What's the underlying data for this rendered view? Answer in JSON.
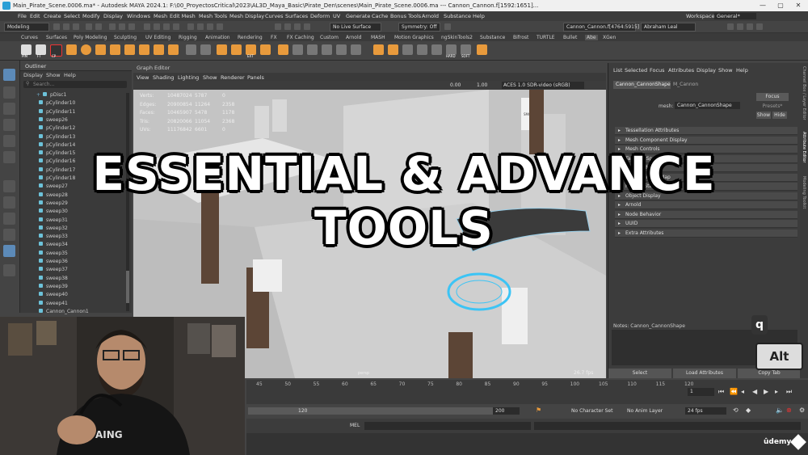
{
  "window": {
    "title": "Main_Pirate_Scene.0006.ma* - Autodesk MAYA 2024.1: F:\\00_ProyectosCritical\\2023\\AL3D_Maya_Basic\\Pirate_Den\\scenes\\Main_Pirate_Scene.0006.ma   ---   Cannon_Cannon.f[1592:1651]...",
    "minimize": "—",
    "maximize": "▢",
    "close": "✕"
  },
  "menubar": [
    "File",
    "Edit",
    "Create",
    "Select",
    "Modify",
    "Display",
    "Windows",
    "Mesh",
    "Edit Mesh",
    "Mesh Tools",
    "Mesh Display",
    "Curves",
    "Surfaces",
    "Deform",
    "UV",
    "Generate",
    "Cache",
    "Bonus Tools",
    "Arnold",
    "Substance",
    "Help"
  ],
  "workspace": {
    "label": "Workspace:",
    "value": "General*"
  },
  "statusline": {
    "mode": "Modeling",
    "live_surface": "No Live Surface",
    "symmetry": "Symmetry: Off",
    "selection_field": "Cannon_Cannon.f[4764:5915]",
    "user": "Abraham Leal"
  },
  "shelf_tabs": [
    "Curves",
    "Surfaces",
    "Poly Modeling",
    "Sculpting",
    "UV Editing",
    "Rigging",
    "Animation",
    "Rendering",
    "FX",
    "FX Caching",
    "Custom",
    "Arnold",
    "MASH",
    "Motion Graphics",
    "ngSkinTools2",
    "Substance",
    "Bifrost",
    "TURTLE",
    "Bullet",
    "Abe",
    "XGen"
  ],
  "shelf_labels": [
    "PIM",
    "FT",
    "CP",
    "EXT",
    "HARD",
    "SOFT"
  ],
  "outliner": {
    "title": "Outliner",
    "menu": [
      "Display",
      "Show",
      "Help"
    ],
    "search_placeholder": "Search...",
    "items": [
      {
        "label": "pDisc1",
        "expand": "+"
      },
      {
        "label": "pCylinder10",
        "expand": ""
      },
      {
        "label": "pCylinder11",
        "expand": ""
      },
      {
        "label": "sweep26",
        "expand": ""
      },
      {
        "label": "pCylinder12",
        "expand": ""
      },
      {
        "label": "pCylinder13",
        "expand": ""
      },
      {
        "label": "pCylinder14",
        "expand": ""
      },
      {
        "label": "pCylinder15",
        "expand": ""
      },
      {
        "label": "pCylinder16",
        "expand": ""
      },
      {
        "label": "pCylinder17",
        "expand": ""
      },
      {
        "label": "pCylinder18",
        "expand": ""
      },
      {
        "label": "sweep27",
        "expand": ""
      },
      {
        "label": "sweep28",
        "expand": ""
      },
      {
        "label": "sweep29",
        "expand": ""
      },
      {
        "label": "sweep30",
        "expand": ""
      },
      {
        "label": "sweep31",
        "expand": ""
      },
      {
        "label": "sweep32",
        "expand": ""
      },
      {
        "label": "sweep33",
        "expand": ""
      },
      {
        "label": "sweep34",
        "expand": ""
      },
      {
        "label": "sweep35",
        "expand": ""
      },
      {
        "label": "sweep36",
        "expand": ""
      },
      {
        "label": "sweep37",
        "expand": ""
      },
      {
        "label": "sweep38",
        "expand": ""
      },
      {
        "label": "sweep39",
        "expand": ""
      },
      {
        "label": "sweep40",
        "expand": ""
      },
      {
        "label": "sweep41",
        "expand": ""
      },
      {
        "label": "Cannon_Cannon1",
        "expand": ""
      }
    ]
  },
  "viewport": {
    "graph_editor_tab": "Graph Editor",
    "menu": [
      "View",
      "Shading",
      "Lighting",
      "Show",
      "Renderer",
      "Panels"
    ],
    "exposure": "0.00",
    "gamma": "1.00",
    "color_space": "ACES 1.0 SDR-video (sRGB)",
    "hud": [
      {
        "label": "Verts:",
        "v1": "10487024",
        "v2": "5787",
        "v3": "0"
      },
      {
        "label": "Edges:",
        "v1": "20900854",
        "v2": "11264",
        "v3": "2358"
      },
      {
        "label": "Faces:",
        "v1": "10465907",
        "v2": "5478",
        "v3": "1178"
      },
      {
        "label": "Tris:",
        "v1": "20820066",
        "v2": "11054",
        "v3": "2368"
      },
      {
        "label": "UVs:",
        "v1": "11176842",
        "v2": "6601",
        "v3": "0"
      }
    ],
    "camera": "persp",
    "fps": "26.7 fps",
    "crate_label": "SMOKE"
  },
  "overlay": {
    "line1": "ESSENTIAL & ADVANCE",
    "line2": "TOOLS"
  },
  "attribute_editor": {
    "menu": [
      "List",
      "Selected",
      "Focus",
      "Attributes",
      "Display",
      "Show",
      "Help"
    ],
    "tabs": [
      "Cannon_CannonShape",
      "M_Cannon"
    ],
    "mesh_label": "mesh:",
    "mesh_value": "Cannon_CannonShape",
    "focus_button": "Focus",
    "presets_button": "Presets*",
    "show_button": "Show",
    "hide_button": "Hide",
    "sections": [
      "Tessellation Attributes",
      "Mesh Component Display",
      "Mesh Controls",
      "Tangent Space",
      "Smooth Mesh",
      "Displacement Map",
      "Render Stats",
      "Object Display",
      "Arnold",
      "Node Behavior",
      "UUID",
      "Extra Attributes"
    ],
    "notes_label": "Notes: Cannon_CannonShape",
    "select_button": "Select",
    "load_button": "Load Attributes",
    "copy_button": "Copy Tab"
  },
  "right_strip": [
    "Channel Box / Layer Editor",
    "Attribute Editor",
    "Modeling Toolkit"
  ],
  "keys": {
    "q": "q",
    "alt": "Alt"
  },
  "timeline": {
    "ticks": [
      "45",
      "50",
      "55",
      "60",
      "65",
      "70",
      "75",
      "80",
      "85",
      "90",
      "95",
      "100",
      "105",
      "110",
      "115",
      "120"
    ],
    "current_frame": "1"
  },
  "range": {
    "end_a": "120",
    "end_b": "200",
    "character_set": "No Character Set",
    "anim_layer": "No Anim Layer",
    "fps": "24 fps"
  },
  "cmdline": {
    "label": "MEL"
  },
  "watermark": "ûdemy"
}
